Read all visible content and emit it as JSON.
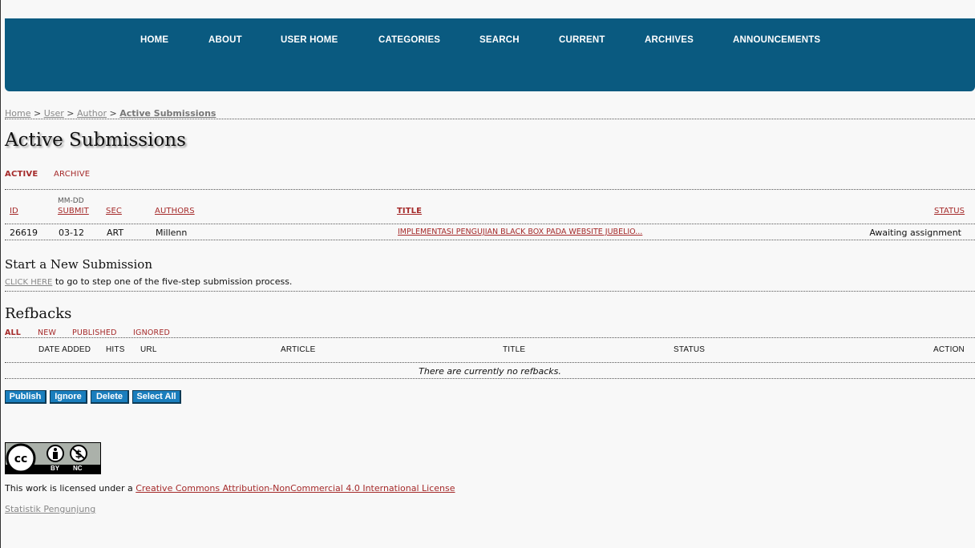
{
  "nav": {
    "items": [
      "HOME",
      "ABOUT",
      "USER HOME",
      "CATEGORIES",
      "SEARCH",
      "CURRENT",
      "ARCHIVES",
      "ANNOUNCEMENTS"
    ]
  },
  "breadcrumb": {
    "home": "Home",
    "sep": ">",
    "user": "User",
    "author": "Author",
    "current": "Active Submissions"
  },
  "page_title": "Active Submissions",
  "tabs": {
    "active": "ACTIVE",
    "archive": "ARCHIVE"
  },
  "submissions": {
    "headers": {
      "mmdd": "MM-DD",
      "id": "ID",
      "submit": "SUBMIT",
      "sec": "SEC",
      "authors": "AUTHORS",
      "title": "TITLE",
      "status": "STATUS"
    },
    "rows": [
      {
        "id": "26619",
        "submit": "03-12",
        "sec": "ART",
        "authors": "Millenn",
        "title": "IMPLEMENTASI PENGUJIAN BLACK BOX PADA WEBSITE JUBELIO...",
        "status": "Awaiting assignment"
      }
    ]
  },
  "new_submission": {
    "heading": "Start a New Submission",
    "link": "CLICK HERE",
    "text": "to go to step one of the five-step submission process."
  },
  "refbacks": {
    "heading": "Refbacks",
    "filters": [
      "ALL",
      "NEW",
      "PUBLISHED",
      "IGNORED"
    ],
    "headers": [
      "DATE ADDED",
      "HITS",
      "URL",
      "ARTICLE",
      "TITLE",
      "STATUS",
      "ACTION"
    ],
    "empty": "There are currently no refbacks.",
    "buttons": [
      "Publish",
      "Ignore",
      "Delete",
      "Select All"
    ]
  },
  "license": {
    "badge_by": "BY",
    "badge_nc": "NC",
    "text": "This work is licensed under a",
    "link": "Creative Commons Attribution-NonCommercial 4.0 International License"
  },
  "footer_link": "Statistik Pengunjung",
  "colors": {
    "nav_bg": "#0a5a80",
    "link_red": "#a52a2a",
    "button_bg": "#1a7ebd"
  }
}
